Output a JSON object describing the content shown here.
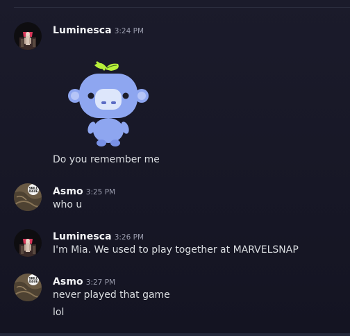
{
  "messages": [
    {
      "author": "Luminesca",
      "time": "3:24 PM",
      "sticker": "wumpus-sticker",
      "lines": [
        "Do you remember me"
      ]
    },
    {
      "author": "Asmo",
      "time": "3:25 PM",
      "lines": [
        "who u"
      ]
    },
    {
      "author": "Luminesca",
      "time": "3:26 PM",
      "lines": [
        "I'm Mia. We used to play together at MARVELSNAP"
      ]
    },
    {
      "author": "Asmo",
      "time": "3:27 PM",
      "lines": [
        "never played that game",
        "lol"
      ]
    }
  ],
  "avatars": {
    "asmo_badge_text": "SKILL ISSUE"
  },
  "colors": {
    "background": "#161624",
    "username": "#f2f3f5",
    "timestamp": "#9a9cad",
    "text": "#dbdee1",
    "wumpus_blue": "#8ea6f0",
    "leaf_green": "#b8f03a"
  }
}
